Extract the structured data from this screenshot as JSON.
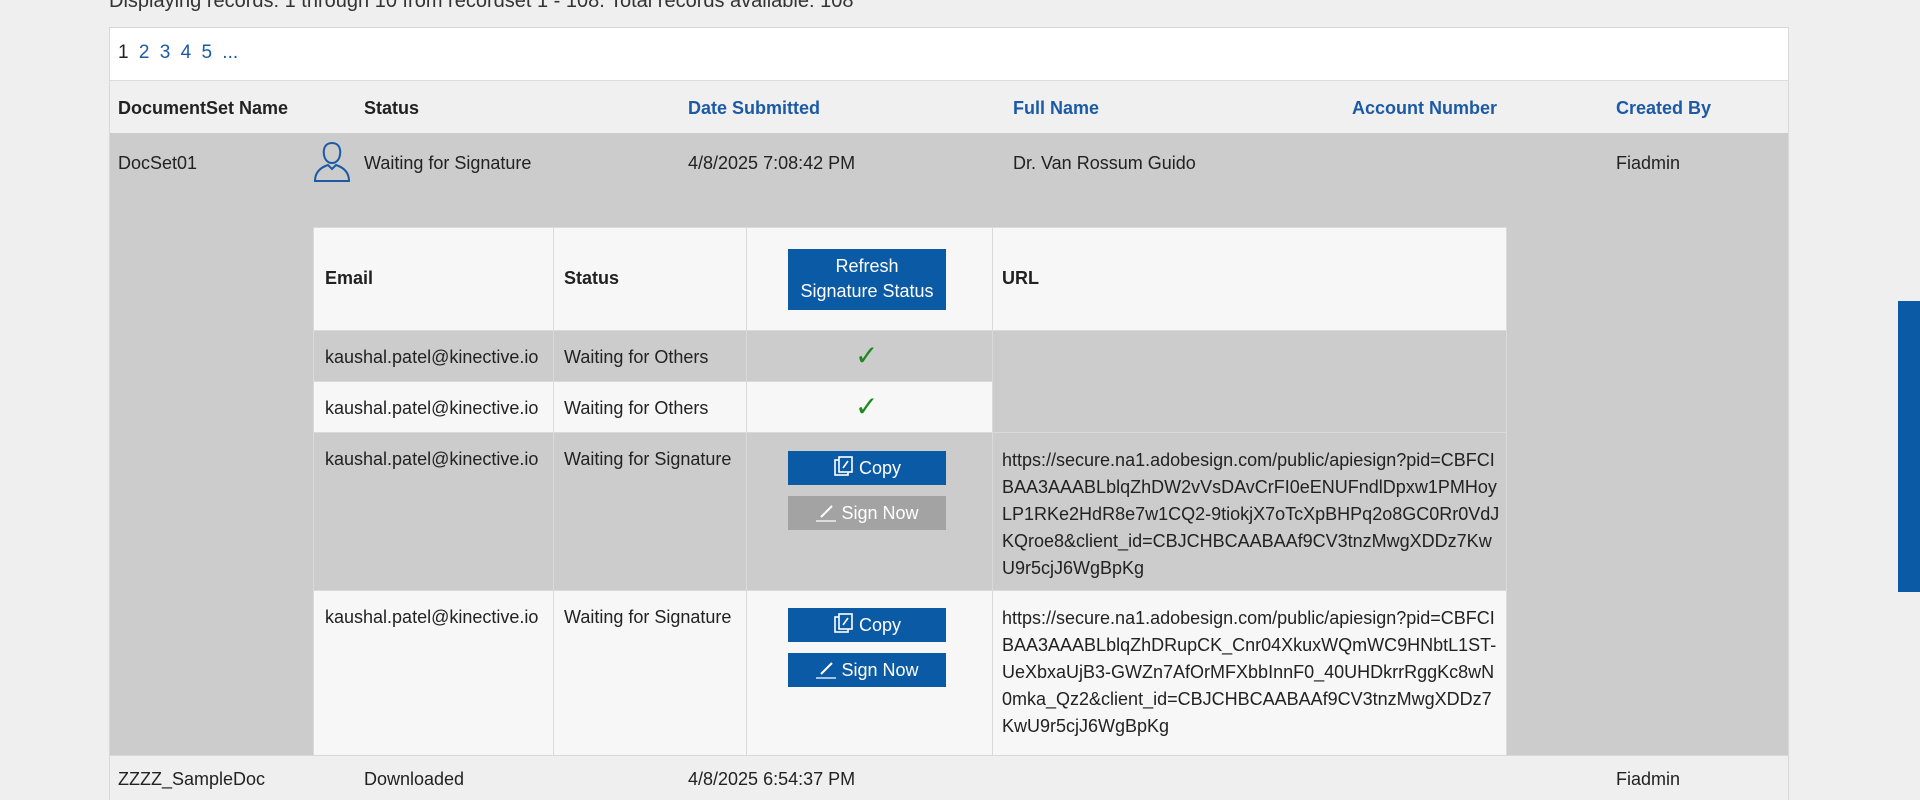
{
  "summary": "Displaying records: 1 through 10 from recordset 1 - 108. Total records available: 108",
  "pager": {
    "current": "1",
    "pages": [
      "2",
      "3",
      "4",
      "5",
      "..."
    ]
  },
  "columns": {
    "docset": "DocumentSet Name",
    "status": "Status",
    "date": "Date Submitted",
    "fullname": "Full Name",
    "account": "Account Number",
    "created": "Created By"
  },
  "rows": [
    {
      "docset": "DocSet01",
      "status": "Waiting for Signature",
      "date": "4/8/2025 7:08:42 PM",
      "fullname": "Dr. Van Rossum Guido",
      "account": "",
      "created": "Fiadmin",
      "signers_header": {
        "email": "Email",
        "status": "Status",
        "refresh_btn_line1": "Refresh",
        "refresh_btn_line2": "Signature Status",
        "url": "URL"
      },
      "signers": [
        {
          "email": "kaushal.patel@kinective.io",
          "status": "Waiting for Others",
          "check": "✓"
        },
        {
          "email": "kaushal.patel@kinective.io",
          "status": "Waiting for Others",
          "check": "✓"
        },
        {
          "email": "kaushal.patel@kinective.io",
          "status": "Waiting for Signature",
          "copy": "Copy",
          "sign": "Sign Now",
          "url": "https://secure.na1.adobesign.com/public/apiesign?pid=CBFCIBAA3AAABLblqZhDW2vVsDAvCrFI0eENUFndlDpxw1PMHoyLP1RKe2HdR8e7w1CQ2-9tiokjX7oTcXpBHPq2o8GC0Rr0VdJKQroe8&client_id=CBJCHBCAABAAf9CV3tnzMwgXDDz7KwU9r5cjJ6WgBpKg"
        },
        {
          "email": "kaushal.patel@kinective.io",
          "status": "Waiting for Signature",
          "copy": "Copy",
          "sign": "Sign Now",
          "url": "https://secure.na1.adobesign.com/public/apiesign?pid=CBFCIBAA3AAABLblqZhDRupCK_Cnr04XkuxWQmWC9HNbtL1ST-UeXbxaUjB3-GWZn7AfOrMFXbbInnF0_40UHDkrrRggKc8wN0mka_Qz2&client_id=CBJCHBCAABAAf9CV3tnzMwgXDDz7KwU9r5cjJ6WgBpKg"
        }
      ]
    },
    {
      "docset": "ZZZZ_SampleDoc",
      "status": "Downloaded",
      "date": "4/8/2025 6:54:37 PM",
      "fullname": "",
      "account": "",
      "created": "Fiadmin"
    }
  ]
}
